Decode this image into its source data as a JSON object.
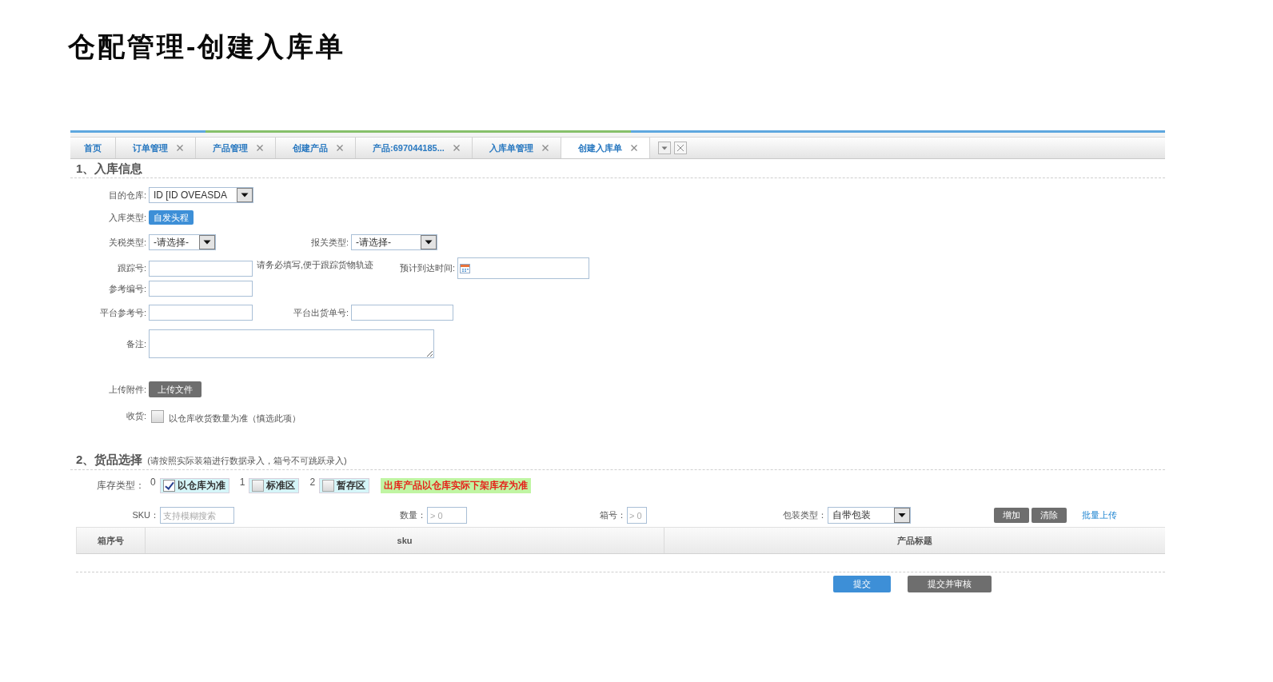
{
  "page_title": "仓配管理-创建入库单",
  "tabs": [
    {
      "label": "首页",
      "closable": false,
      "selected": false
    },
    {
      "label": "订单管理",
      "closable": true,
      "selected": false
    },
    {
      "label": "产品管理",
      "closable": true,
      "selected": false
    },
    {
      "label": "创建产品",
      "closable": true,
      "selected": false
    },
    {
      "label": "产品:697044185...",
      "closable": true,
      "selected": false
    },
    {
      "label": "入库单管理",
      "closable": true,
      "selected": false
    },
    {
      "label": "创建入库单",
      "closable": true,
      "selected": true
    }
  ],
  "inbound_info": {
    "title": "1、入库信息",
    "rows": [
      [
        {
          "kind": "select",
          "label": "目的仓库:",
          "value": "ID [ID OVEASDA"
        }
      ],
      [
        {
          "kind": "button",
          "label": "入库类型:",
          "button": "自发头程"
        }
      ],
      [
        {
          "kind": "select",
          "label": "关税类型:",
          "value": "-请选择-"
        },
        {
          "kind": "select",
          "label": "报关类型:",
          "value": "-请选择-"
        }
      ],
      [
        {
          "kind": "input",
          "label": "跟踪号:",
          "note": "请务必填写,便于跟踪货物轨迹"
        },
        {
          "kind": "date",
          "label": "预计到达时间:"
        }
      ],
      [
        {
          "kind": "input",
          "label": "参考编号:"
        }
      ],
      [
        {
          "kind": "input",
          "label": "平台参考号:"
        },
        {
          "kind": "input",
          "label": "平台出货单号:"
        }
      ],
      [
        {
          "kind": "textarea",
          "label": "备注:"
        }
      ],
      [
        {
          "kind": "upload",
          "label": "上传附件:",
          "button": "上传文件"
        }
      ],
      [
        {
          "kind": "checkbox",
          "label": "收货:",
          "checked": false,
          "text": "以仓库收货数量为准（慎选此项）"
        }
      ]
    ]
  },
  "goods_selection": {
    "title": "2、货品选择",
    "note": "(请按照实际装箱进行数据录入，箱号不可跳跃录入)",
    "stock_type": {
      "label": "库存类型：",
      "options": [
        {
          "index": "0",
          "label": "以仓库为准",
          "checked": true
        },
        {
          "index": "1",
          "label": "标准区",
          "checked": false
        },
        {
          "index": "2",
          "label": "暂存区",
          "checked": false
        }
      ],
      "notice": "出库产品以仓库实际下架库存为准"
    },
    "filters": {
      "sku": {
        "label": "SKU：",
        "placeholder": "支持模糊搜索"
      },
      "quantity": {
        "label": "数量：",
        "placeholder": "> 0"
      },
      "box_number": {
        "label": "箱号：",
        "placeholder": "> 0"
      },
      "package_type": {
        "label": "包装类型：",
        "value": "自带包装"
      },
      "buttons": [
        "增加",
        "清除"
      ],
      "link": "批量上传"
    },
    "table": {
      "columns": [
        "箱序号",
        "sku",
        "产品标题"
      ]
    }
  },
  "footer_buttons": [
    {
      "label": "提交",
      "kind": "primary"
    },
    {
      "label": "提交并审核",
      "kind": "secondary"
    }
  ]
}
